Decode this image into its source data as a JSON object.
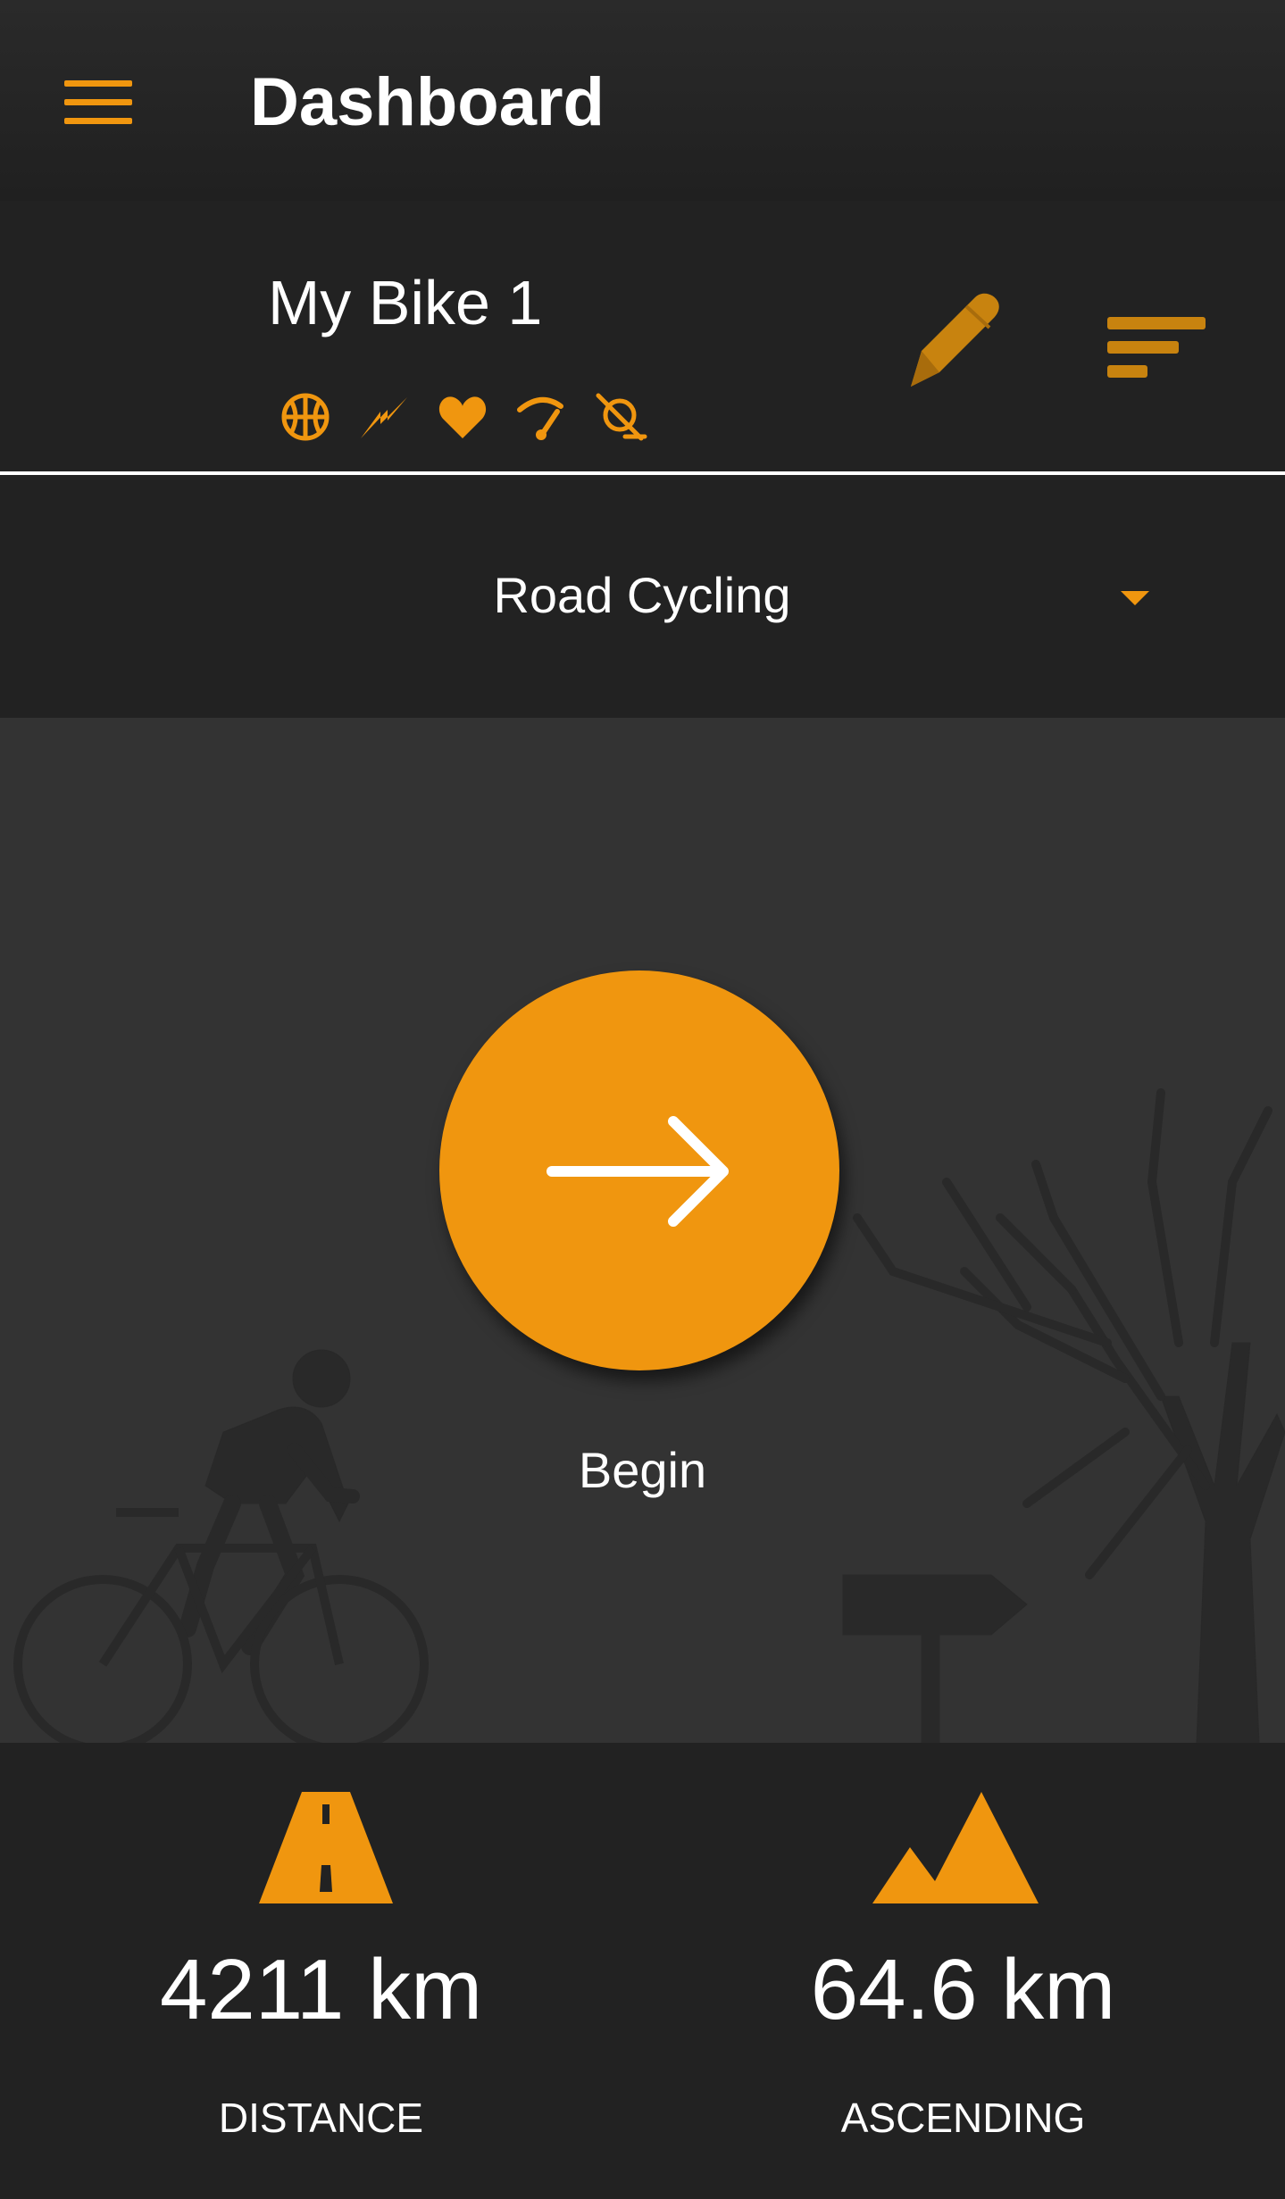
{
  "app_bar": {
    "title": "Dashboard",
    "menu_icon": "hamburger-menu-icon"
  },
  "bike": {
    "name": "My Bike 1",
    "sensor_icons": [
      "wheel-sensor-icon",
      "power-sensor-icon",
      "heart-rate-icon",
      "speed-sensor-icon",
      "cadence-sensor-icon"
    ],
    "edit_icon": "pencil-icon",
    "sort_icon": "sort-icon"
  },
  "activity": {
    "selected": "Road Cycling",
    "caret_icon": "caret-down-icon"
  },
  "start": {
    "label": "Begin",
    "icon": "arrow-right-icon"
  },
  "stats": [
    {
      "value": "4211 km",
      "label": "DISTANCE",
      "icon": "road-icon"
    },
    {
      "value": "64.6 km",
      "label": "ASCENDING",
      "icon": "mountains-icon"
    }
  ],
  "colors": {
    "accent": "#F0960F",
    "background": "#222222",
    "hero_background": "#333333"
  }
}
